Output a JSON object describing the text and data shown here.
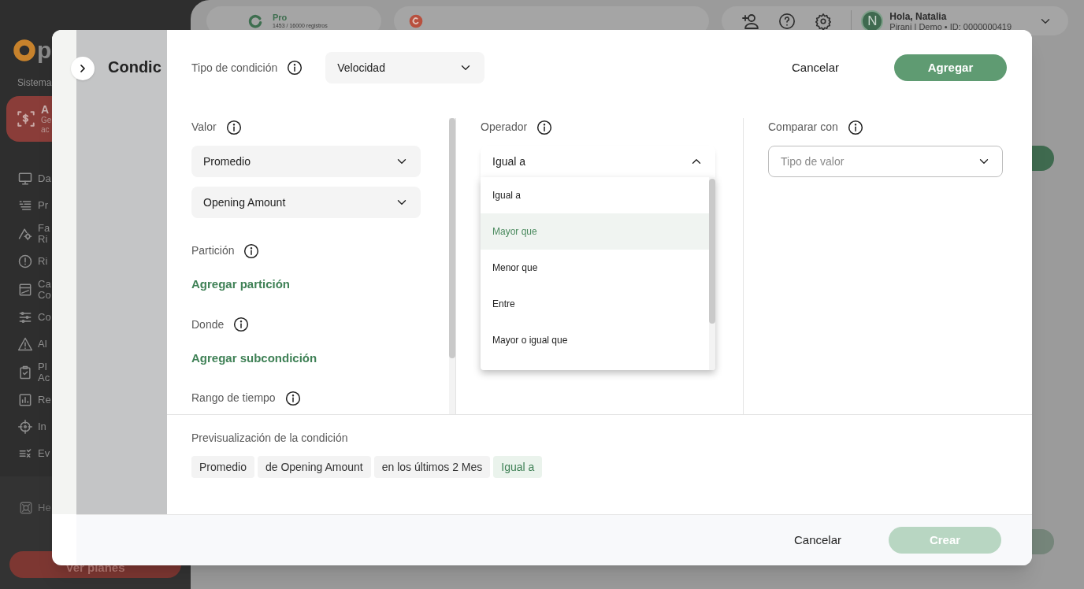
{
  "sidebar": {
    "logo_text": "p",
    "section_label": "Sistema",
    "system_card": {
      "title": "A",
      "lines": [
        "Ge",
        "ac"
      ]
    },
    "items": [
      {
        "lines": [
          "Da"
        ]
      },
      {
        "lines": [
          "Pr"
        ]
      },
      {
        "lines": [
          "Fa",
          "Ri"
        ]
      },
      {
        "lines": [
          "Ri"
        ]
      },
      {
        "lines": [
          "Ca",
          "Co"
        ]
      },
      {
        "lines": [
          "Co"
        ]
      },
      {
        "lines": [
          "Al"
        ]
      },
      {
        "lines": [
          "Pl",
          "Ac"
        ]
      },
      {
        "lines": [
          "Re"
        ]
      },
      {
        "lines": [
          "In"
        ]
      },
      {
        "lines": [
          "Ev"
        ]
      }
    ],
    "help_item": "He",
    "plans_button": "Ver planes"
  },
  "topbar": {
    "plan": {
      "name": "Pro",
      "usage": "1453 / 16000 registros"
    },
    "user": {
      "avatar": "N",
      "greeting": "Hola, Natalia",
      "account": "Pirani | Demo • ID: 0000000419"
    }
  },
  "panel": {
    "title": "Condic"
  },
  "dialog": {
    "condition_type": {
      "label": "Tipo de condición",
      "value": "Velocidad"
    },
    "cancel_top": "Cancelar",
    "add_button": "Agregar",
    "value_column": {
      "label": "Valor",
      "selects": [
        "Promedio",
        "Opening Amount"
      ],
      "partition_label": "Partición",
      "partition_link": "Agregar partición",
      "where_label": "Donde",
      "where_link": "Agregar subcondición",
      "range_label": "Rango de tiempo"
    },
    "operator_column": {
      "label": "Operador",
      "value": "Igual a",
      "expanded": true,
      "options": [
        {
          "label": "Igual a",
          "highlighted": false
        },
        {
          "label": "Mayor que",
          "highlighted": true
        },
        {
          "label": "Menor que",
          "highlighted": false
        },
        {
          "label": "Entre",
          "highlighted": false
        },
        {
          "label": "Mayor o igual que",
          "highlighted": false
        }
      ]
    },
    "compare_column": {
      "label": "Comparar con",
      "placeholder": "Tipo de valor"
    },
    "preview": {
      "label": "Previsualización de la condición",
      "chips": [
        {
          "text": "Promedio",
          "kind": "value"
        },
        {
          "text": "de Opening Amount",
          "kind": "value"
        },
        {
          "text": "en los últimos 2 Mes",
          "kind": "value"
        },
        {
          "text": "Igual a",
          "kind": "operator"
        }
      ]
    }
  },
  "footer": {
    "cancel": "Cancelar",
    "create": {
      "label": "Crear",
      "disabled": true
    }
  }
}
